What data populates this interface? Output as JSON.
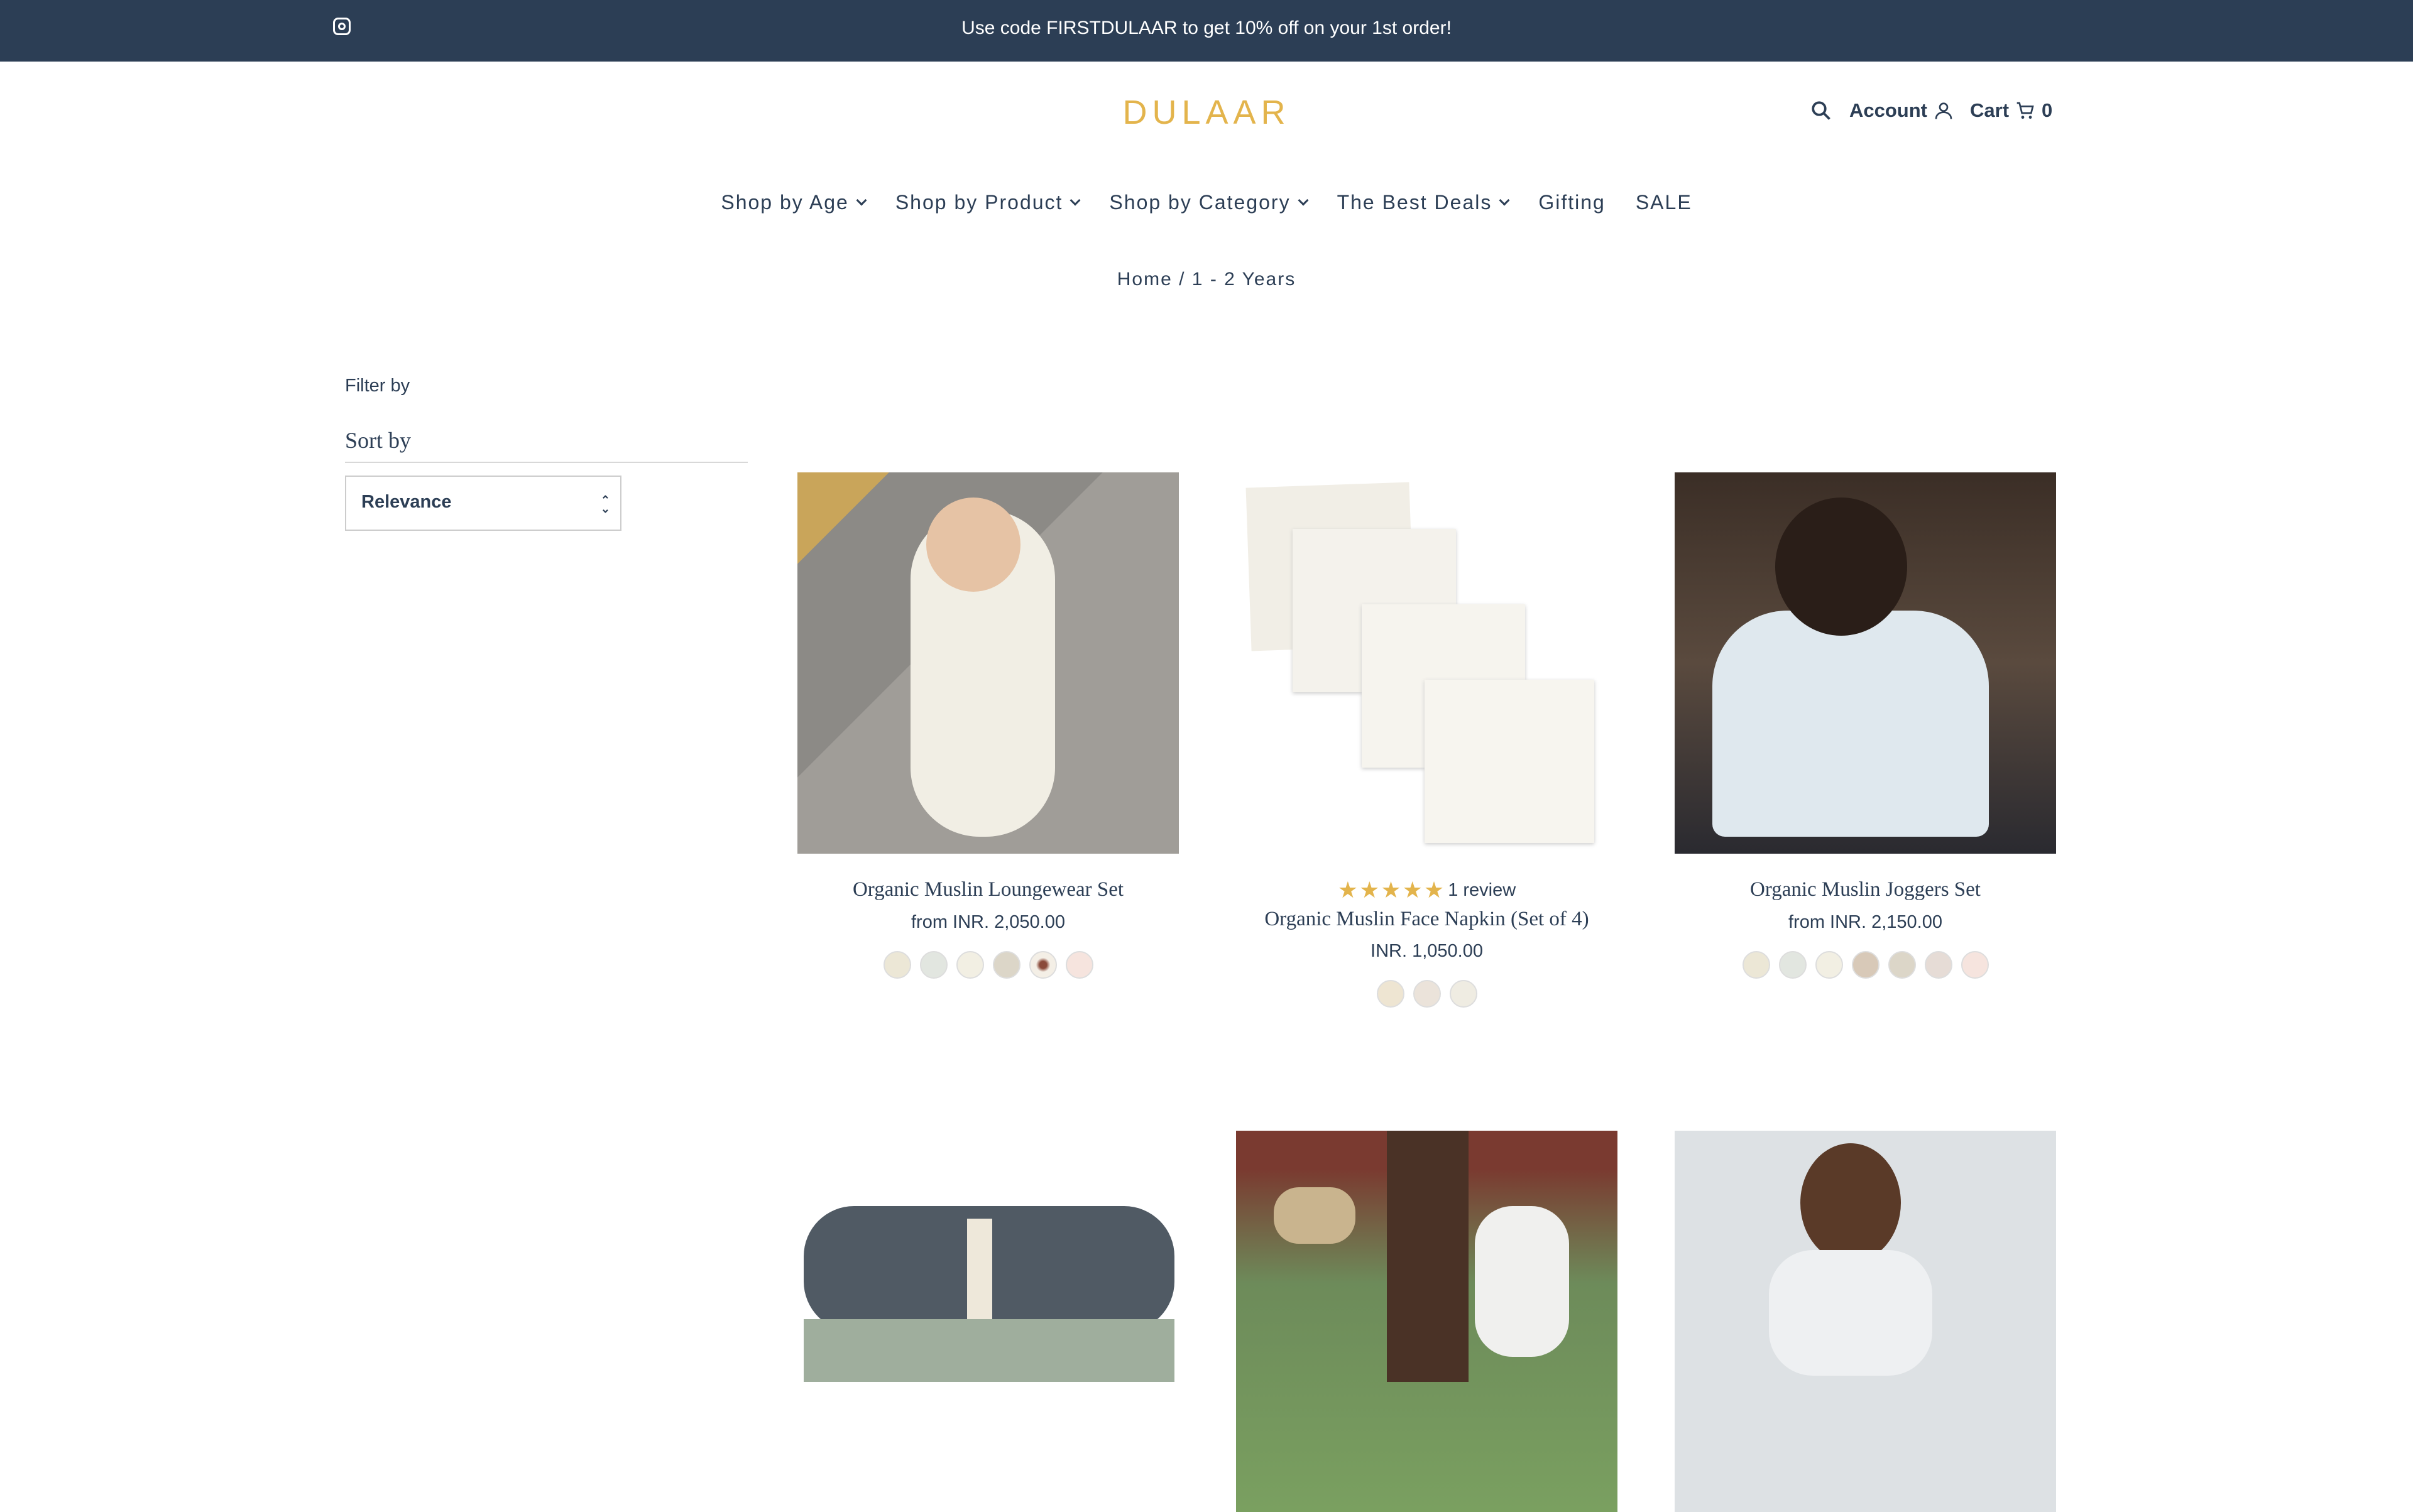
{
  "announcement": {
    "text": "Use code FIRSTDULAAR to get 10% off on your 1st order!",
    "icon": "instagram-icon"
  },
  "header": {
    "logo": "DULAAR",
    "account": "Account",
    "cart": "Cart",
    "cart_count": "0"
  },
  "colors": {
    "brand": "#e3b44c",
    "navy": "#2c3e55"
  },
  "nav": [
    {
      "label": "Shop by Age",
      "dropdown": true
    },
    {
      "label": "Shop by Product",
      "dropdown": true
    },
    {
      "label": "Shop by Category",
      "dropdown": true
    },
    {
      "label": "The Best Deals",
      "dropdown": true
    },
    {
      "label": "Gifting",
      "dropdown": false
    },
    {
      "label": "SALE",
      "dropdown": false
    }
  ],
  "breadcrumb": "Home / 1 - 2 Years",
  "sidebar": {
    "filter_by": "Filter by",
    "sort_by": "Sort by",
    "sort_value": "Relevance"
  },
  "products": [
    {
      "title": "Organic Muslin Loungewear Set",
      "price": "from INR. 2,050.00",
      "swatches": [
        "#ece7d6",
        "#e2e6e0",
        "#f2efe3",
        "#dcd6c8",
        "#8a4a3a",
        "#f6e4de"
      ]
    },
    {
      "title": "Organic Muslin Face Napkin (Set of 4)",
      "price": "INR. 1,050.00",
      "rating": 5,
      "reviews": "1 review",
      "swatches": [
        "#eee5d2",
        "#ebe3da",
        "#efece2"
      ]
    },
    {
      "title": "Organic Muslin Joggers Set",
      "price": "from INR. 2,150.00",
      "swatches": [
        "#ece7d6",
        "#e2e6e0",
        "#f2efe3",
        "#d8c9b8",
        "#dcd6c8",
        "#e6dcd6",
        "#f6e4de"
      ]
    }
  ]
}
